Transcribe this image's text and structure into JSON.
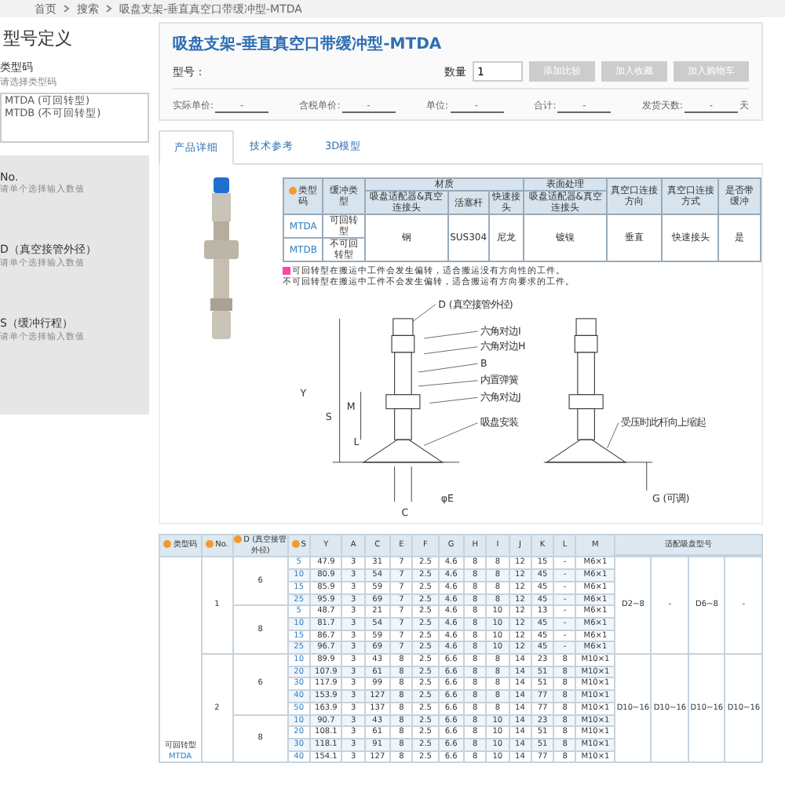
{
  "breadcrumb": [
    "首页",
    "搜索",
    "吸盘支架-垂直真空口带缓冲型-MTDA"
  ],
  "sidebar": {
    "title": "型号定义",
    "type_code": {
      "label": "类型码",
      "hint": "请选择类型码",
      "options": [
        {
          "label": "MTDA (可回转型)",
          "selected": false
        },
        {
          "label": "MTDB (不可回转型)",
          "selected": false
        }
      ]
    },
    "params": [
      {
        "label": "No.",
        "hint": "请单个选择输入数值"
      },
      {
        "label": "D（真空接管外径）",
        "hint": "请单个选择输入数值"
      },
      {
        "label": "S（缓冲行程）",
        "hint": "请单个选择输入数值"
      }
    ]
  },
  "product": {
    "title": "吸盘支架-垂直真空口带缓冲型-MTDA",
    "model_label": "型号：",
    "quantity_label": "数量",
    "quantity": "1",
    "buttons": [
      "添加比较",
      "加入收藏",
      "加入购物车"
    ],
    "prices": [
      {
        "label": "实际单价:",
        "value": "-"
      },
      {
        "label": "含税单价:",
        "value": "-"
      },
      {
        "label": "单位:",
        "value": "-"
      },
      {
        "label": "合计:",
        "value": "-"
      },
      {
        "label": "发货天数:",
        "value": "-",
        "unit": "天"
      }
    ]
  },
  "tabs": [
    {
      "label": "产品详细",
      "selected": true
    },
    {
      "label": "技术参考",
      "selected": false
    },
    {
      "label": "3D模型",
      "selected": false
    }
  ],
  "spec_table": {
    "headers": [
      "类型码",
      "缓冲类型",
      "材质",
      "表面处理",
      "真空口连接方向",
      "真空口连接方式",
      "是否带缓冲"
    ],
    "subheaders": [
      "吸盘适配器&真空连接头",
      "活塞杆",
      "快速接头",
      "吸盘适配器&真空连接头"
    ],
    "rows": [
      {
        "code": "MTDA",
        "buffer": "可回转型"
      },
      {
        "code": "MTDB",
        "buffer": "不可回转型"
      }
    ],
    "shared": [
      "钢",
      "SUS304",
      "尼龙",
      "镀镍",
      "垂直",
      "快速接头",
      "是"
    ]
  },
  "notes": [
    "可回转型在搬运中工件会发生偏转，适合搬运没有方向性的工件。",
    "不可回转型在搬运中工件不会发生偏转，适合搬运有方向要求的工件。"
  ],
  "drawing": {
    "labels": [
      "D (真空接管外径)",
      "六角对边I",
      "六角对边H",
      "B",
      "内置弹簧",
      "六角对边J",
      "吸盘安装",
      "受压时此杆向上缩起"
    ],
    "dims": [
      "Y",
      "M",
      "S",
      "L",
      "φE",
      "C",
      "G (可调)"
    ]
  },
  "dims_table": {
    "columns": [
      "类型码",
      "No.",
      "D (真空接管外径)",
      "S",
      "Y",
      "A",
      "C",
      "E",
      "F",
      "G",
      "H",
      "I",
      "J",
      "K",
      "L",
      "M"
    ],
    "pad_header": "适配吸盘型号",
    "type_label": "可回转型",
    "type_code": "MTDA",
    "groups": [
      {
        "no": "1",
        "pads": [
          "D2~8",
          "-",
          "D6~8",
          "-"
        ],
        "subgroups": [
          {
            "d": "6",
            "rows": [
              [
                "5",
                "47.9",
                "3",
                "31",
                "7",
                "2.5",
                "4.6",
                "8",
                "8",
                "12",
                "15",
                "-",
                "M6×1"
              ],
              [
                "10",
                "80.9",
                "3",
                "54",
                "7",
                "2.5",
                "4.6",
                "8",
                "8",
                "12",
                "45",
                "-",
                "M6×1"
              ],
              [
                "15",
                "85.9",
                "3",
                "59",
                "7",
                "2.5",
                "4.6",
                "8",
                "8",
                "12",
                "45",
                "-",
                "M6×1"
              ],
              [
                "25",
                "95.9",
                "3",
                "69",
                "7",
                "2.5",
                "4.6",
                "8",
                "8",
                "12",
                "45",
                "-",
                "M6×1"
              ]
            ]
          },
          {
            "d": "8",
            "rows": [
              [
                "5",
                "48.7",
                "3",
                "21",
                "7",
                "2.5",
                "4.6",
                "8",
                "10",
                "12",
                "13",
                "-",
                "M6×1"
              ],
              [
                "10",
                "81.7",
                "3",
                "54",
                "7",
                "2.5",
                "4.6",
                "8",
                "10",
                "12",
                "45",
                "-",
                "M6×1"
              ],
              [
                "15",
                "86.7",
                "3",
                "59",
                "7",
                "2.5",
                "4.6",
                "8",
                "10",
                "12",
                "45",
                "-",
                "M6×1"
              ],
              [
                "25",
                "96.7",
                "3",
                "69",
                "7",
                "2.5",
                "4.6",
                "8",
                "10",
                "12",
                "45",
                "-",
                "M6×1"
              ]
            ]
          }
        ]
      },
      {
        "no": "2",
        "pads": [
          "D10~16",
          "D10~16",
          "D10~16",
          "D10~16"
        ],
        "subgroups": [
          {
            "d": "6",
            "rows": [
              [
                "10",
                "89.9",
                "3",
                "43",
                "8",
                "2.5",
                "6.6",
                "8",
                "8",
                "14",
                "23",
                "8",
                "M10×1"
              ],
              [
                "20",
                "107.9",
                "3",
                "61",
                "8",
                "2.5",
                "6.6",
                "8",
                "8",
                "14",
                "51",
                "8",
                "M10×1"
              ],
              [
                "30",
                "117.9",
                "3",
                "99",
                "8",
                "2.5",
                "6.6",
                "8",
                "8",
                "14",
                "51",
                "8",
                "M10×1"
              ],
              [
                "40",
                "153.9",
                "3",
                "127",
                "8",
                "2.5",
                "6.6",
                "8",
                "8",
                "14",
                "77",
                "8",
                "M10×1"
              ],
              [
                "50",
                "163.9",
                "3",
                "137",
                "8",
                "2.5",
                "6.6",
                "8",
                "8",
                "14",
                "77",
                "8",
                "M10×1"
              ]
            ]
          },
          {
            "d": "8",
            "rows": [
              [
                "10",
                "90.7",
                "3",
                "43",
                "8",
                "2.5",
                "6.6",
                "8",
                "10",
                "14",
                "23",
                "8",
                "M10×1"
              ],
              [
                "20",
                "108.1",
                "3",
                "61",
                "8",
                "2.5",
                "6.6",
                "8",
                "10",
                "14",
                "51",
                "8",
                "M10×1"
              ],
              [
                "30",
                "118.1",
                "3",
                "91",
                "8",
                "2.5",
                "6.6",
                "8",
                "10",
                "14",
                "51",
                "8",
                "M10×1"
              ],
              [
                "40",
                "154.1",
                "3",
                "127",
                "8",
                "2.5",
                "6.6",
                "8",
                "10",
                "14",
                "77",
                "8",
                "M10×1"
              ]
            ]
          }
        ]
      }
    ]
  }
}
